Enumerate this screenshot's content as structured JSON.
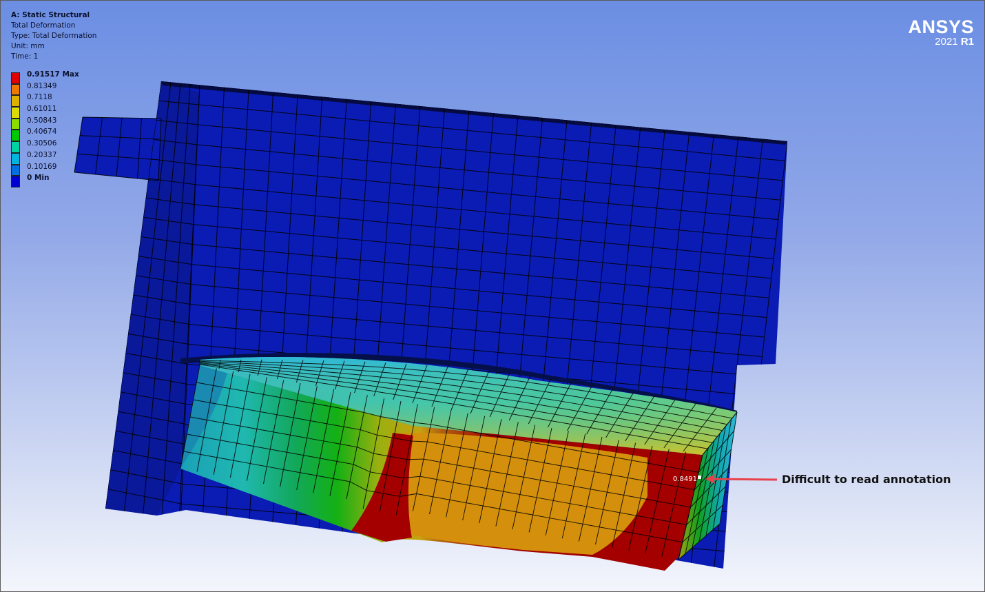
{
  "header": {
    "system": "A: Static Structural",
    "result": "Total Deformation",
    "type": "Type: Total Deformation",
    "unit": "Unit: mm",
    "time": "Time: 1"
  },
  "legend": [
    {
      "label": "0.91517 Max",
      "color": "#e00000"
    },
    {
      "label": "0.81349",
      "color": "#f07800"
    },
    {
      "label": "0.7118",
      "color": "#e0b000"
    },
    {
      "label": "0.61011",
      "color": "#dcdc00"
    },
    {
      "label": "0.50843",
      "color": "#8cdc00"
    },
    {
      "label": "0.40674",
      "color": "#00c800"
    },
    {
      "label": "0.30506",
      "color": "#00d2a0"
    },
    {
      "label": "0.20337",
      "color": "#00b4dc"
    },
    {
      "label": "0.10169",
      "color": "#0070e0"
    },
    {
      "label": "0 Min",
      "color": "#0000d2"
    }
  ],
  "logo": {
    "brand": "ANSYS",
    "year": "2021",
    "release": "R1"
  },
  "probe_label": "0.8491",
  "annotation": "Difficult to read annotation",
  "colors": {
    "model_base": "#0a1cb4",
    "mesh_line": "#000000",
    "arrow": "#e8414a",
    "max_red": "#a80000",
    "orange_face": "#d0880c"
  }
}
